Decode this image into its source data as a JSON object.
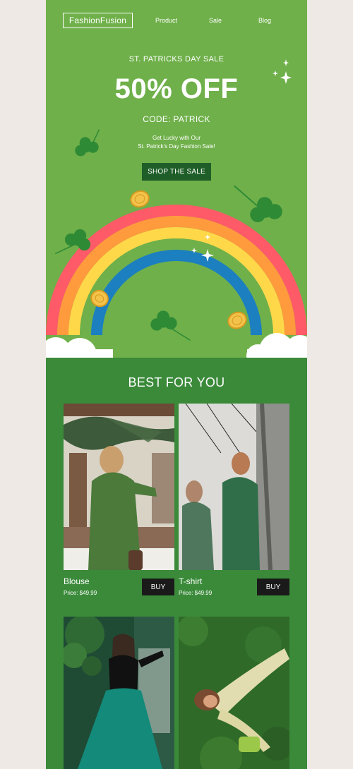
{
  "brand": {
    "logo_text": "FashionFusion"
  },
  "nav": {
    "items": [
      "Product",
      "Sale",
      "Blog"
    ]
  },
  "hero": {
    "eyebrow": "ST. PATRICKS DAY SALE",
    "headline": "50% OFF",
    "code": "CODE: PATRICK",
    "tagline_line1": "Get Lucky with Our",
    "tagline_line2": "St. Patrick's Day Fashion Sale!",
    "cta_label": "SHOP THE SALE"
  },
  "products_section": {
    "title": "BEST FOR YOU",
    "items": [
      {
        "name": "Blouse",
        "price": "Price: $49.99",
        "buy_label": "BUY"
      },
      {
        "name": "T-shirt",
        "price": "Price: $49.99",
        "buy_label": "BUY"
      },
      {
        "name": "",
        "price": "",
        "buy_label": ""
      },
      {
        "name": "",
        "price": "",
        "buy_label": ""
      }
    ]
  },
  "colors": {
    "page_background": "#efe9e5",
    "hero_green": "#6fb04a",
    "section_green": "#3a8a3a",
    "cta_dark_green": "#1f5e28",
    "buy_button": "#1a1a1a",
    "rainbow": [
      "#ff5a68",
      "#ff9a3d",
      "#ffd84a",
      "#6fb04a",
      "#1c7fc0"
    ],
    "coin": "#f3c24a",
    "clover": "#2e8a35"
  },
  "icons": [
    "clover-icon",
    "gold-coin-icon",
    "sparkle-icon",
    "rainbow-illustration",
    "cloud-shape"
  ]
}
